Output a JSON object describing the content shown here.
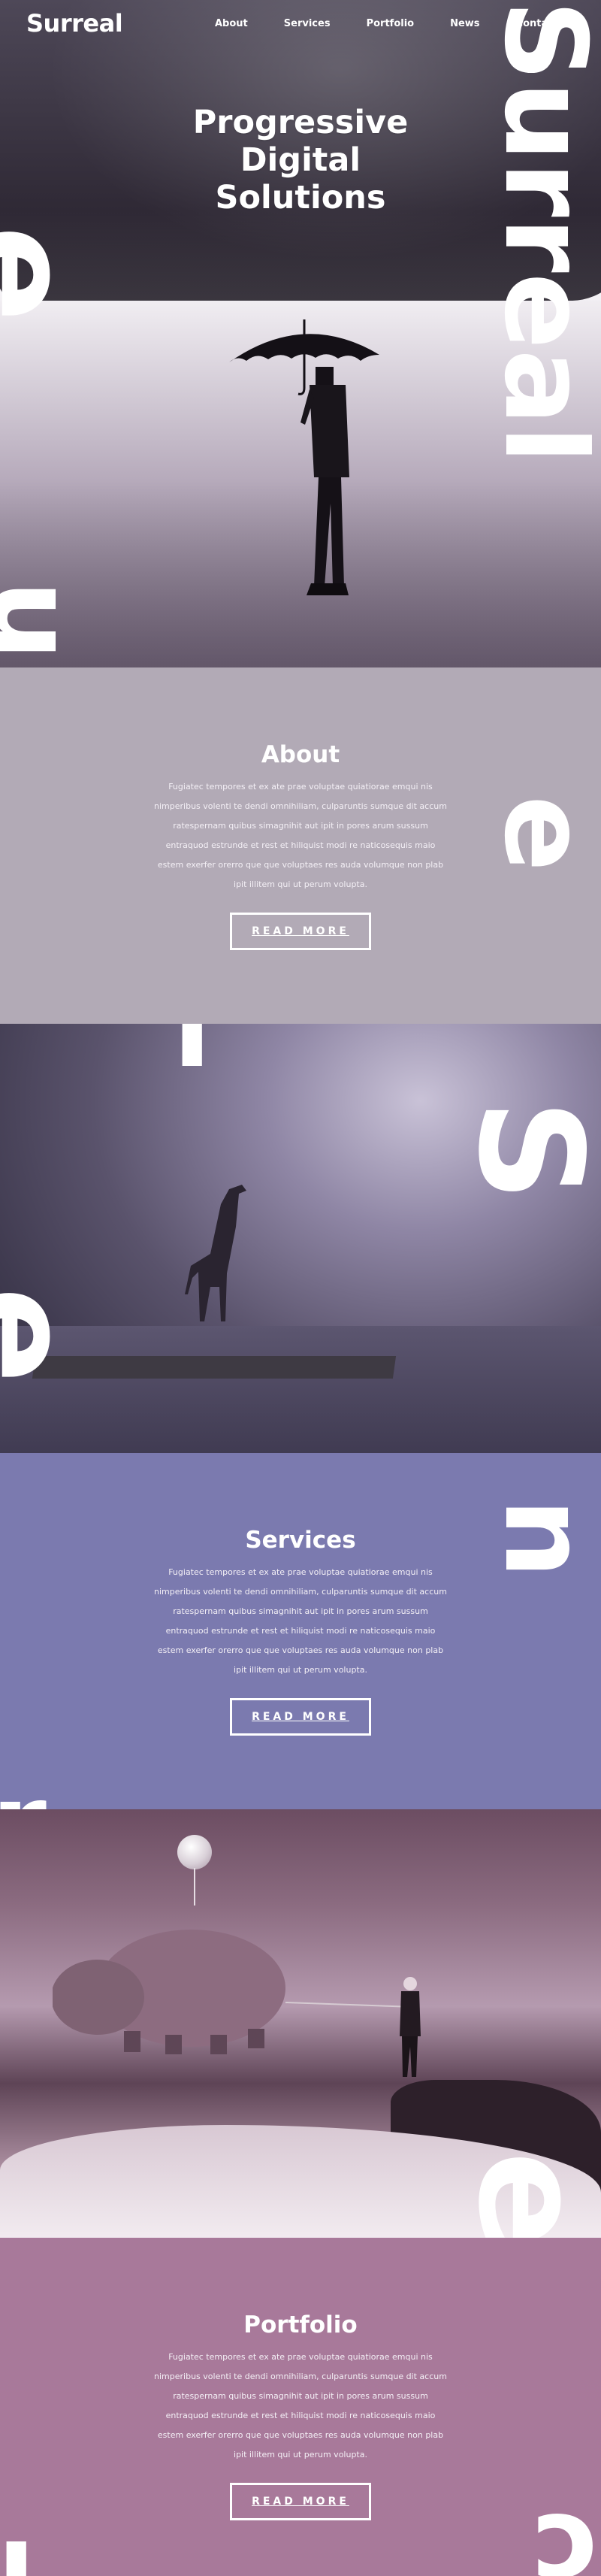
{
  "brand": {
    "logo_text": "Surreal"
  },
  "nav": {
    "items": [
      {
        "label": "About"
      },
      {
        "label": "Services"
      },
      {
        "label": "Portfolio"
      },
      {
        "label": "News"
      },
      {
        "label": "Contact"
      }
    ]
  },
  "hero": {
    "title_lines": [
      "Progressive",
      "Digital",
      "Solutions"
    ]
  },
  "sections": {
    "about": {
      "title": "About",
      "text": "Fugiatec tempores et ex ate prae voluptae quiatiorae emqui nis nimperibus volenti te dendi omnihiliam, culparuntis sumque dit accum ratespernam quibus simagnihit aut ipit in pores arum sussum entraquod estrunde et rest et hiliquist modi re naticosequis maio estem exerfer orerro que que voluptaes res auda volumque non plab ipit illitem qui ut perum volupta.",
      "button_label": "READ MORE"
    },
    "services": {
      "title": "Services",
      "text": "Fugiatec tempores et ex ate prae voluptae quiatiorae emqui nis nimperibus volenti te dendi omnihiliam, culparuntis sumque dit accum ratespernam quibus simagnihit aut ipit in pores arum sussum entraquod estrunde et rest et hiliquist modi re naticosequis maio estem exerfer orerro que que voluptaes res auda volumque non plab ipit illitem qui ut perum volupta.",
      "button_label": "READ MORE"
    },
    "portfolio": {
      "title": "Portfolio",
      "text": "Fugiatec tempores et ex ate prae voluptae quiatiorae emqui nis nimperibus volenti te dendi omnihiliam, culparuntis sumque dit accum ratespernam quibus simagnihit aut ipit in pores arum sussum entraquod estrunde et rest et hiliquist modi re naticosequis maio estem exerfer orerro que que voluptaes res auda volumque non plab ipit illitem qui ut perum volupta.",
      "button_label": "READ MORE"
    }
  },
  "colors": {
    "about_bg": "#b2aab6",
    "services_bg": "#7b7aaf",
    "portfolio_bg": "#a8799a",
    "text": "#ffffff"
  },
  "icons": {
    "hero_image": "umbrella-man-illustration",
    "giraffe_image": "giraffe-on-raft-illustration",
    "hippo_image": "floating-hippo-balloon-illustration"
  }
}
